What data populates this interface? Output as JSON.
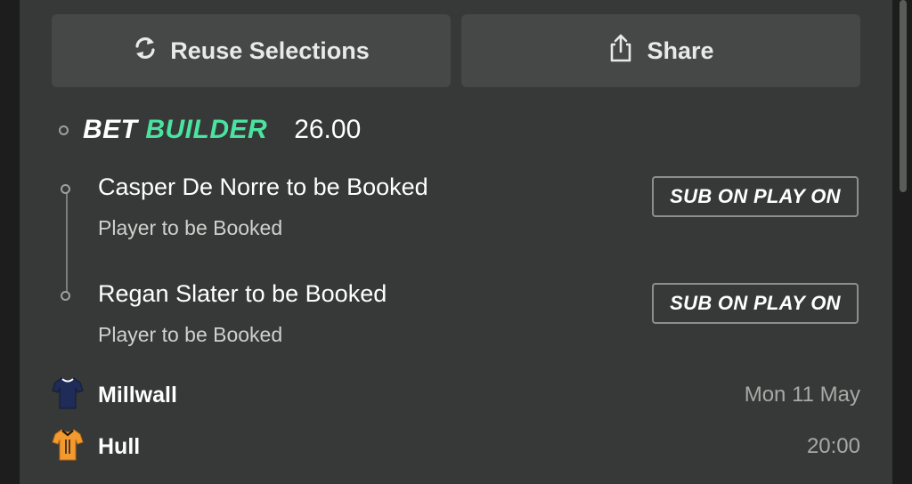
{
  "actions": {
    "reuse_label": "Reuse Selections",
    "share_label": "Share"
  },
  "bet_builder": {
    "title_part1": "BET",
    "title_part2": "BUILDER",
    "odds": "26.00",
    "accent_color": "#4be3a1"
  },
  "selections": [
    {
      "title": "Casper De Norre to be Booked",
      "market": "Player to be Booked",
      "badge": "SUB ON PLAY ON"
    },
    {
      "title": "Regan Slater to be Booked",
      "market": "Player to be Booked",
      "badge": "SUB ON PLAY ON"
    }
  ],
  "match": {
    "home": {
      "name": "Millwall",
      "icon": "millwall-shirt-icon",
      "color": "#1f2c57"
    },
    "away": {
      "name": "Hull",
      "icon": "hull-shirt-icon",
      "color": "#f29a2e"
    },
    "date": "Mon 11 May",
    "time": "20:00"
  }
}
